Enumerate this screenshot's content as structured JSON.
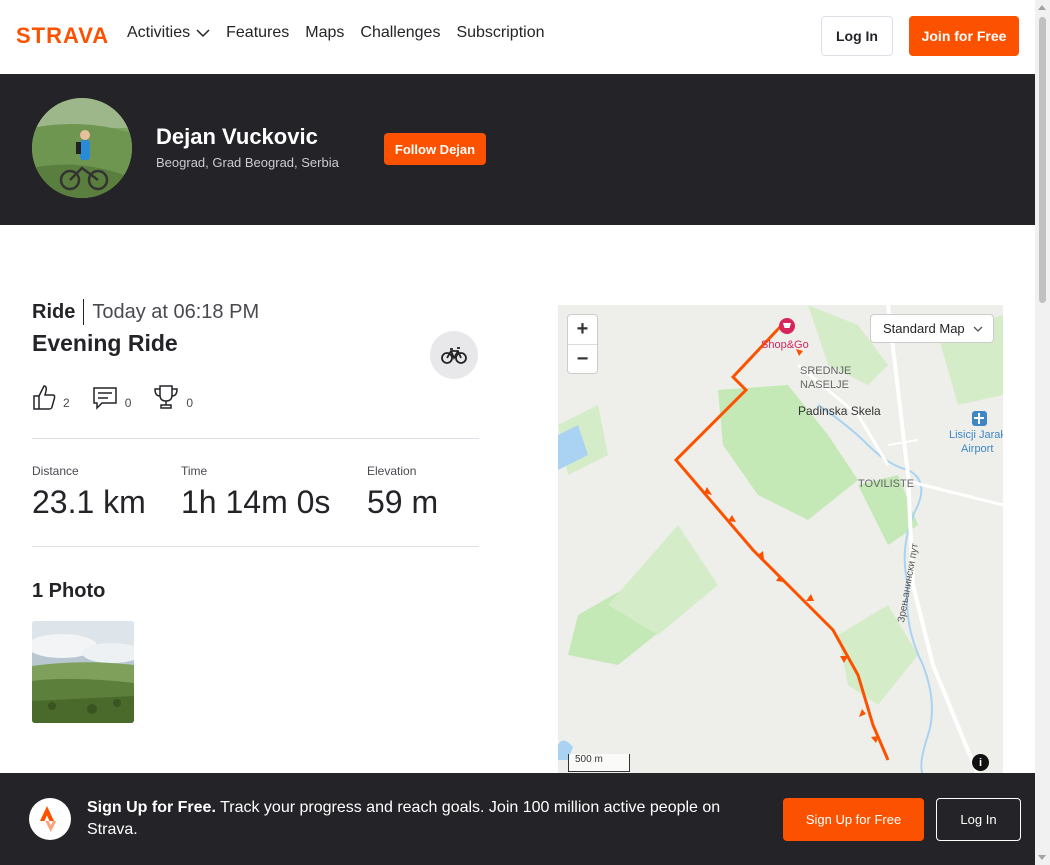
{
  "nav": {
    "logo_text": "STRAVA",
    "links": [
      "Activities",
      "Features",
      "Maps",
      "Challenges",
      "Subscription"
    ],
    "login_label": "Log In",
    "join_label": "Join for Free"
  },
  "athlete": {
    "name": "Dejan Vuckovic",
    "location": "Beograd, Grad Beograd, Serbia",
    "follow_label": "Follow Dejan"
  },
  "activity": {
    "type": "Ride",
    "time": "Today at 06:18 PM",
    "title": "Evening Ride",
    "kudos_count": "2",
    "comments_count": "0",
    "achievements_count": "0",
    "stats": [
      {
        "label": "Distance",
        "value": "23.1 km"
      },
      {
        "label": "Time",
        "value": "1h 14m 0s"
      },
      {
        "label": "Elevation",
        "value": "59 m"
      }
    ],
    "photos_title": "1 Photo"
  },
  "map": {
    "zoom_in": "+",
    "zoom_out": "−",
    "style_select": "Standard Map",
    "scale_label": "500 m",
    "info": "i",
    "labels": {
      "shop": "Shop&Go",
      "srednje_1": "SREDNJE",
      "srednje_2": "NASELJE",
      "padinska": "Padinska Skela",
      "airport_1": "Lisicji Jarak",
      "airport_2": "Airport",
      "toviliste": "TOVILISTE",
      "road": "Зрењанински пут"
    },
    "colors": {
      "route": "#fc5200",
      "land": "#eeefea",
      "green": "#c5e8b7",
      "water": "#aad3f3"
    }
  },
  "banner": {
    "title": "Sign Up for Free.",
    "text": "Track your progress and reach goals. Join 100 million active people on Strava.",
    "signup_label": "Sign Up for Free",
    "login_label": "Log In"
  },
  "brand_color": "#fc5200"
}
